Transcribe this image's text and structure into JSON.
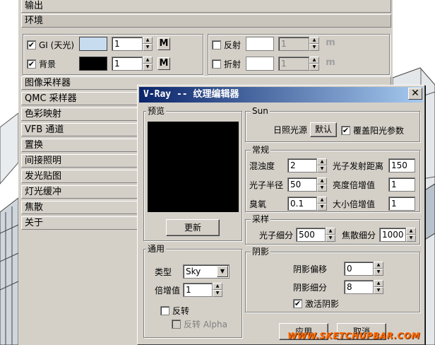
{
  "main_panel": {
    "rollouts": [
      "输出",
      "环境",
      "图像采样器",
      "QMC 采样器",
      "色彩映射",
      "VFB 通道",
      "置换",
      "间接照明",
      "发光贴图",
      "灯光缓冲",
      "焦散",
      "关于"
    ],
    "environment": {
      "gi_label": "GI (天光)",
      "gi_value": "1",
      "gi_color": "#c8dcf0",
      "bg_label": "背景",
      "bg_value": "1",
      "bg_color": "#000000",
      "map_button": "M",
      "reflection_label": "反射",
      "reflection_value": "1",
      "refraction_label": "折射",
      "refraction_value": "1",
      "map_button_disabled": "m"
    }
  },
  "dialog": {
    "title": "V-Ray -- 纹理编辑器",
    "close_icon": "close-icon",
    "preview": {
      "group_label": "预览",
      "update_button": "更新"
    },
    "general": {
      "group_label": "通用",
      "type_label": "类型",
      "type_value": "Sky",
      "multiplier_label": "倍增值",
      "multiplier_value": "1",
      "invert_label": "反转",
      "invert_alpha_label": "反转 Alpha"
    },
    "sun": {
      "group_label": "Sun",
      "sun_source_label": "日照光源",
      "default_button": "默认",
      "override_label": "覆盖阳光参数",
      "override_checked": true
    },
    "common": {
      "group_label": "常规",
      "turbidity_label": "混浊度",
      "turbidity_value": "2",
      "photon_emit_radius_label": "光子发射距离",
      "photon_emit_radius_value": "150",
      "photon_radius_label": "光子半径",
      "photon_radius_value": "50",
      "intensity_mult_label": "亮度倍增值",
      "intensity_mult_value": "1",
      "ozone_label": "臭氧",
      "ozone_value": "0.1",
      "size_mult_label": "大小倍增值",
      "size_mult_value": "1"
    },
    "sampling": {
      "group_label": "采样",
      "photon_subdivs_label": "光子细分",
      "photon_subdivs_value": "500",
      "caustic_subdivs_label": "焦散细分",
      "caustic_subdivs_value": "1000"
    },
    "shadows": {
      "group_label": "阴影",
      "shadow_bias_label": "阴影偏移",
      "shadow_bias_value": "0",
      "shadow_subdivs_label": "阴影细分",
      "shadow_subdivs_value": "8",
      "enable_shadows_label": "激活阴影",
      "enable_shadows_checked": true
    },
    "buttons": {
      "apply": "应用",
      "cancel": "取消"
    },
    "watermark": "WWW.SKETCHUPBAR.COM"
  }
}
